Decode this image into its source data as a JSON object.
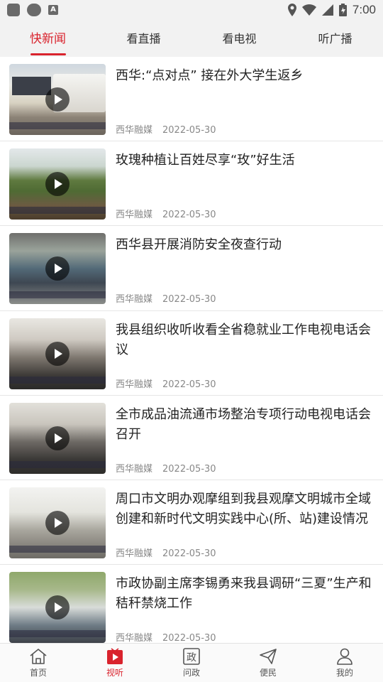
{
  "status_bar": {
    "time": "7:00",
    "badge": "A"
  },
  "top_tabs": [
    {
      "label": "快新闻",
      "active": true
    },
    {
      "label": "看直播",
      "active": false
    },
    {
      "label": "看电视",
      "active": false
    },
    {
      "label": "听广播",
      "active": false
    }
  ],
  "news": [
    {
      "title": "西华:“点对点” 接在外大学生返乡",
      "source": "西华融媒",
      "date": "2022-05-30"
    },
    {
      "title": "玫瑰种植让百姓尽享“玫”好生活",
      "source": "西华融媒",
      "date": "2022-05-30"
    },
    {
      "title": "西华县开展消防安全夜查行动",
      "source": "西华融媒",
      "date": "2022-05-30"
    },
    {
      "title": "我县组织收听收看全省稳就业工作电视电话会议",
      "source": "西华融媒",
      "date": "2022-05-30"
    },
    {
      "title": "全市成品油流通市场整治专项行动电视电话会召开",
      "source": "西华融媒",
      "date": "2022-05-30"
    },
    {
      "title": "周口市文明办观摩组到我县观摩文明城市全域创建和新时代文明实践中心(所、站)建设情况",
      "source": "西华融媒",
      "date": "2022-05-30"
    },
    {
      "title": "市政协副主席李锡勇来我县调研“三夏”生产和秸秆禁烧工作",
      "source": "西华融媒",
      "date": "2022-05-30"
    }
  ],
  "bottom_nav": [
    {
      "label": "首页",
      "icon": "home-icon",
      "active": false
    },
    {
      "label": "视听",
      "icon": "play-tv-icon",
      "active": true
    },
    {
      "label": "问政",
      "icon": "wenzheng-icon",
      "active": false
    },
    {
      "label": "便民",
      "icon": "send-icon",
      "active": false
    },
    {
      "label": "我的",
      "icon": "user-icon",
      "active": false
    }
  ],
  "colors": {
    "accent": "#d9232d",
    "bar_bg": "#f2f2f2"
  }
}
